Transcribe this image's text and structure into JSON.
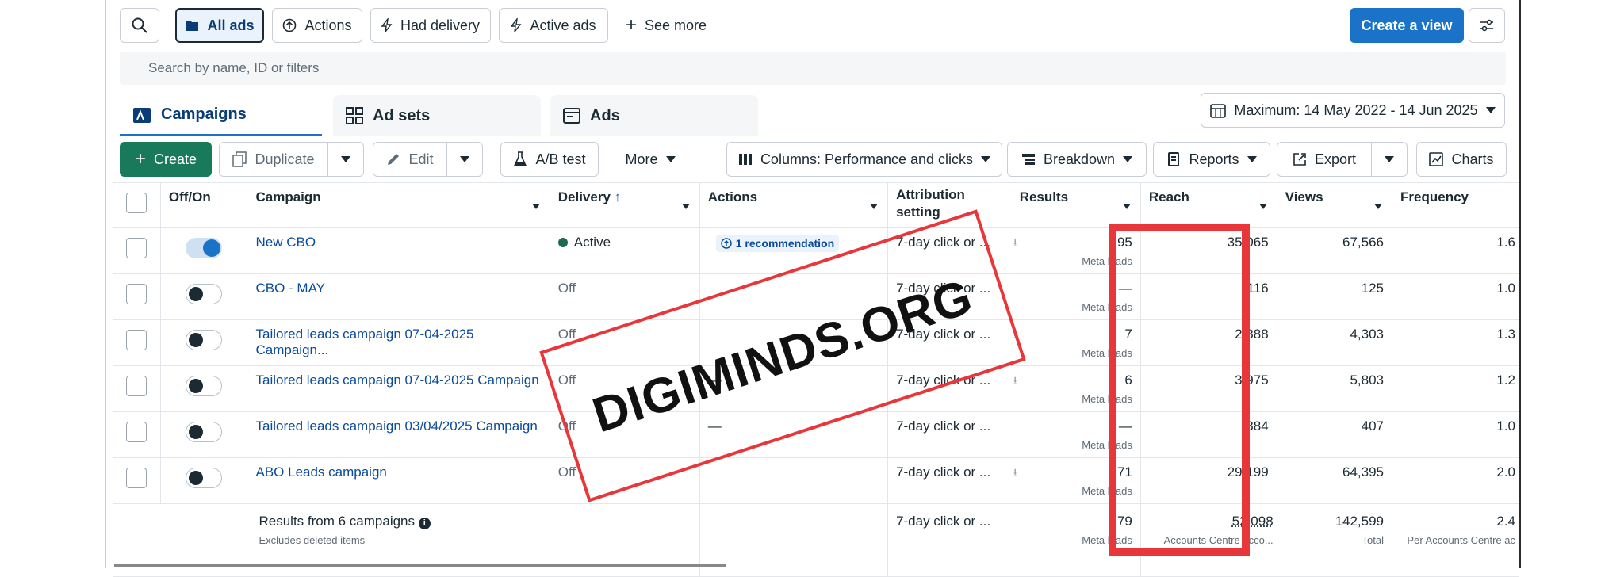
{
  "toolbar": {
    "filters": [
      {
        "label": "All ads",
        "icon": "folder-icon"
      },
      {
        "label": "Actions",
        "icon": "circle-arrow-up-icon"
      },
      {
        "label": "Had delivery",
        "icon": "bolt-icon"
      },
      {
        "label": "Active ads",
        "icon": "bolt-icon"
      },
      {
        "label": "See more",
        "icon": "plus-icon"
      }
    ],
    "create_view_label": "Create a view"
  },
  "search": {
    "placeholder": "Search by name, ID or filters"
  },
  "tabs": [
    {
      "label": "Campaigns",
      "icon": "campaign-icon",
      "active": true
    },
    {
      "label": "Ad sets",
      "icon": "grid-icon",
      "active": false
    },
    {
      "label": "Ads",
      "icon": "ad-icon",
      "active": false
    }
  ],
  "date_range": {
    "label": "Maximum: 14 May 2022 - 14 Jun 2025"
  },
  "actions": {
    "create": "Create",
    "duplicate": "Duplicate",
    "edit": "Edit",
    "ab_test": "A/B test",
    "more": "More",
    "columns": "Columns: Performance and clicks",
    "breakdown": "Breakdown",
    "reports": "Reports",
    "export": "Export",
    "charts": "Charts"
  },
  "table": {
    "headers": {
      "offon": "Off/On",
      "campaign": "Campaign",
      "delivery": "Delivery",
      "actions": "Actions",
      "attribution_1": "Attribution",
      "attribution_2": "setting",
      "results": "Results",
      "reach": "Reach",
      "views": "Views",
      "frequency": "Frequency"
    },
    "rows": [
      {
        "on": true,
        "name": "New CBO",
        "delivery": "Active",
        "actions": "1 recommendation",
        "attribution": "7-day click or ...",
        "results": "95",
        "results_sub": "Meta leads",
        "reach": "35,065",
        "views": "67,566",
        "frequency": "1.6"
      },
      {
        "on": false,
        "name": "CBO - MAY",
        "delivery": "Off",
        "actions": "",
        "attribution": "7-day click or ...",
        "results": "—",
        "results_sub": "Meta leads",
        "reach": "116",
        "views": "125",
        "frequency": "1.0"
      },
      {
        "on": false,
        "name": "Tailored leads campaign 07-04-2025 Campaign...",
        "delivery": "Off",
        "actions": "",
        "attribution": "7-day click or ...",
        "results": "7",
        "results_sub": "Meta leads",
        "reach": "2,888",
        "views": "4,303",
        "frequency": "1.3"
      },
      {
        "on": false,
        "name": "Tailored leads campaign 07-04-2025 Campaign",
        "delivery": "Off",
        "actions": "—",
        "attribution": "7-day click or ...",
        "results": "6",
        "results_sub": "Meta leads",
        "reach": "3,975",
        "views": "5,803",
        "frequency": "1.2"
      },
      {
        "on": false,
        "name": "Tailored leads campaign 03/04/2025 Campaign",
        "delivery": "Off",
        "actions": "—",
        "attribution": "7-day click or ...",
        "results": "—",
        "results_sub": "Meta leads",
        "reach": "384",
        "views": "407",
        "frequency": "1.0"
      },
      {
        "on": false,
        "name": "ABO Leads campaign",
        "delivery": "Off",
        "actions": "",
        "attribution": "7-day click or ...",
        "results": "71",
        "results_sub": "Meta leads",
        "reach": "29,199",
        "views": "64,395",
        "frequency": "2.0"
      }
    ],
    "summary": {
      "title": "Results from 6 campaigns",
      "subtitle": "Excludes deleted items",
      "attribution": "7-day click or ...",
      "results": "179",
      "results_sub": "Meta leads",
      "reach": "52,098",
      "reach_sub": "Accounts Centre acco...",
      "views": "142,599",
      "views_sub": "Total",
      "frequency": "2.4",
      "frequency_sub": "Per Accounts Centre ac"
    }
  },
  "watermark": {
    "text": "DIGIMINDS.ORG"
  },
  "colors": {
    "accent": "#1a73c8",
    "create_green": "#197a5b",
    "highlight_red": "#e8373b"
  }
}
